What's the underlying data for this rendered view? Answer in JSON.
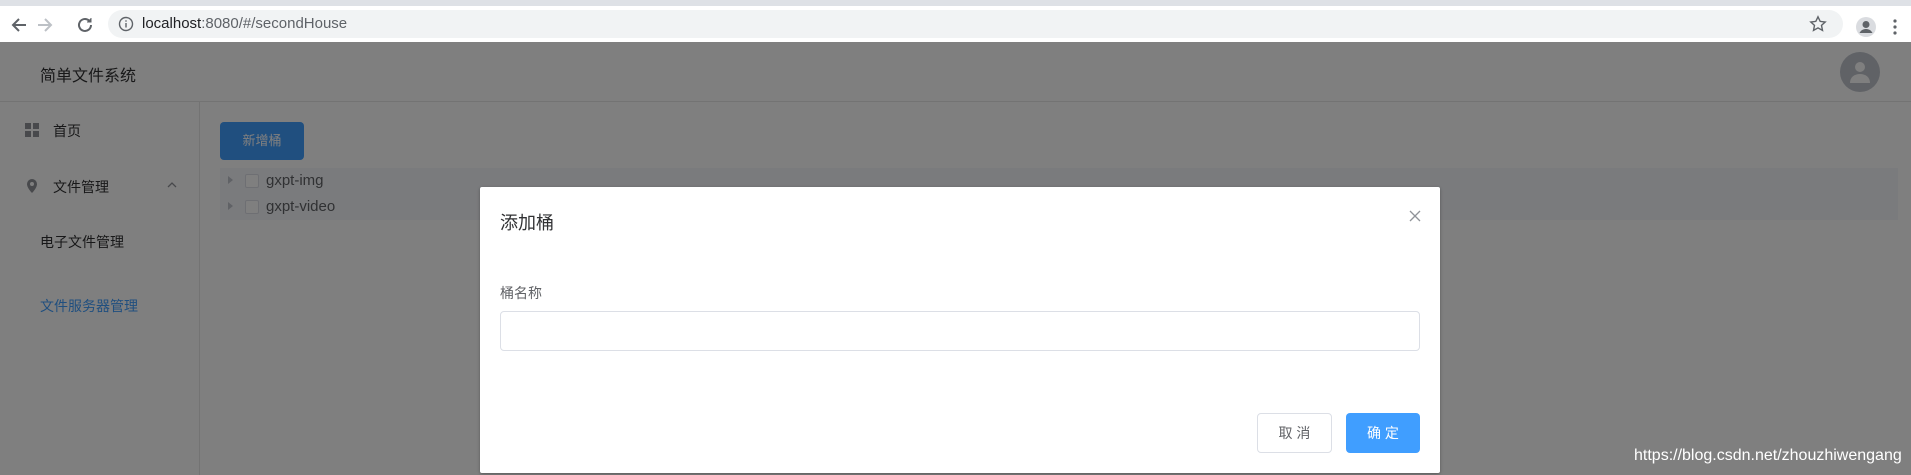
{
  "browser": {
    "url_host": "localhost",
    "url_rest": ":8080/#/secondHouse",
    "icons": [
      "back-arrow-icon",
      "forward-arrow-icon",
      "reload-icon",
      "info-icon",
      "star-icon",
      "profile-icon",
      "kebab-menu-icon"
    ]
  },
  "app": {
    "title": "简单文件系统"
  },
  "sidebar": {
    "items": [
      {
        "label": "首页",
        "icon": "grid-icon"
      },
      {
        "label": "文件管理",
        "icon": "location-icon"
      }
    ],
    "submenu": [
      {
        "label": "电子文件管理"
      },
      {
        "label": "文件服务器管理",
        "active": true
      }
    ]
  },
  "main": {
    "new_bucket_label": "新增桶",
    "tree": [
      {
        "label": "gxpt-img"
      },
      {
        "label": "gxpt-video"
      }
    ]
  },
  "dialog": {
    "title": "添加桶",
    "field_label": "桶名称",
    "field_value": "",
    "cancel_label": "取 消",
    "confirm_label": "确 定"
  },
  "watermark": "https://blog.csdn.net/zhouzhiwengang",
  "colors": {
    "primary": "#409eff",
    "overlay": "rgba(0,0,0,0.5)"
  }
}
